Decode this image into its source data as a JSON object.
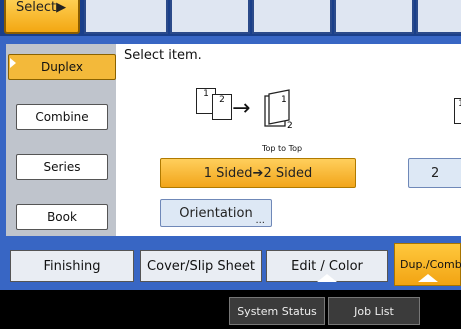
{
  "top": {
    "select_label": "Select▶"
  },
  "instruction": "Select item.",
  "side_menu": [
    {
      "label": "Duplex",
      "active": true
    },
    {
      "label": "Combine"
    },
    {
      "label": "Series"
    },
    {
      "label": "Book"
    }
  ],
  "diagram": {
    "page1": "1",
    "page2": "2",
    "result_front": "1",
    "result_back": "2",
    "caption": "Top to Top",
    "partial_page": "1"
  },
  "options": {
    "selected_label": "1 Sided➔2 Sided",
    "second_label": "2",
    "orientation_label": "Orientation",
    "orientation_more": "..."
  },
  "tabs": [
    {
      "label": "Finishing"
    },
    {
      "label": "Cover/Slip Sheet"
    },
    {
      "label": "Edit / Color"
    },
    {
      "label": "Dup./Combin",
      "active": true
    }
  ],
  "bottom": {
    "system_status": "System Status",
    "job_list": "Job List"
  },
  "colors": {
    "accent": "#f3b93a",
    "panel_blue": "#3866c4",
    "button_blue": "#dde8f5"
  }
}
